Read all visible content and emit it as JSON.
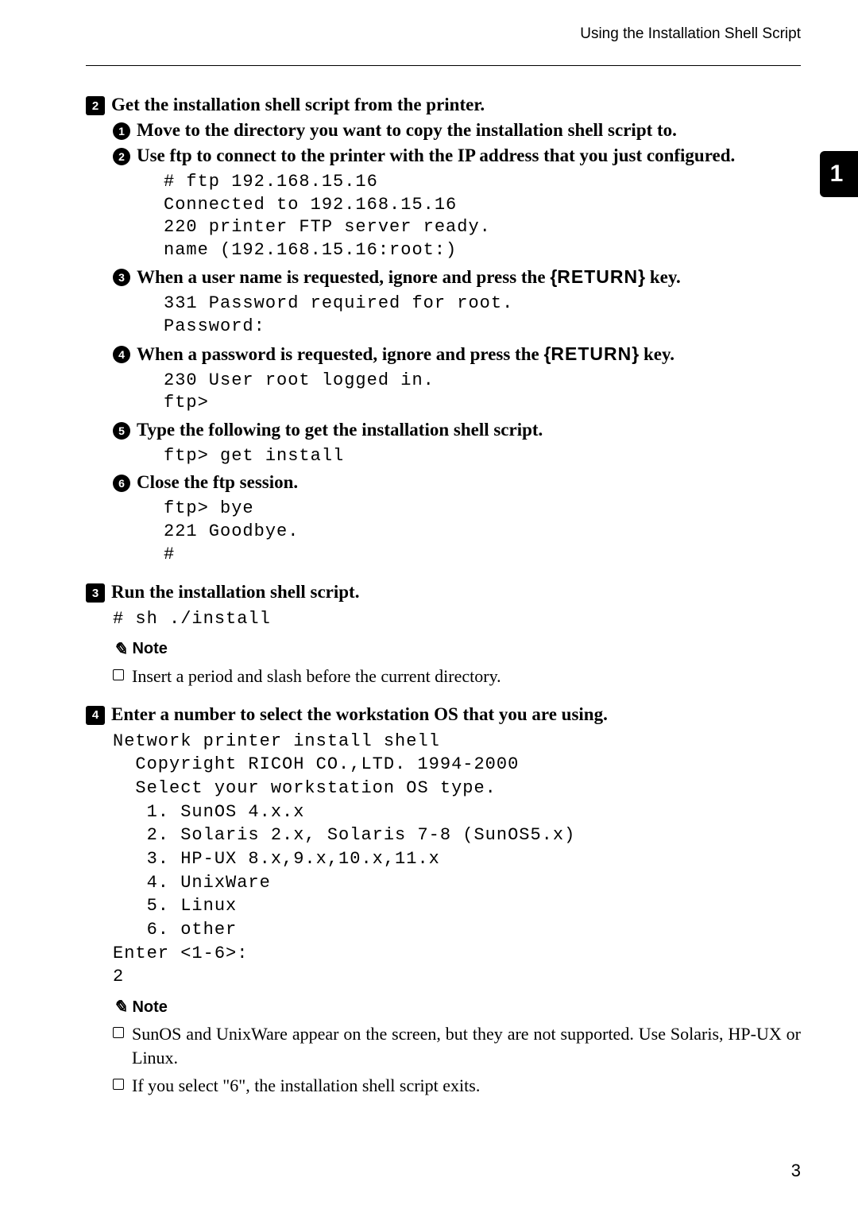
{
  "header": {
    "section_title": "Using the Installation Shell Script"
  },
  "side_tab": "1",
  "page_number": "3",
  "steps": {
    "s2": {
      "num": "2",
      "text": "Get the installation shell script from the printer.",
      "subs": {
        "a": {
          "num": "1",
          "text": "Move to the directory you want to copy the installation shell script to."
        },
        "b": {
          "num": "2",
          "text": "Use ftp to connect to the printer with the IP address that you just configured.",
          "code": "# ftp 192.168.15.16\nConnected to 192.168.15.16\n220 printer FTP server ready.\nname (192.168.15.16:root:)"
        },
        "c": {
          "num": "3",
          "text_pre": "When a user name is requested, ignore and press the ",
          "key": "RETURN",
          "text_post": " key.",
          "code": "331 Password required for root.\nPassword:"
        },
        "d": {
          "num": "4",
          "text_pre": "When a password is requested, ignore and press the ",
          "key": "RETURN",
          "text_post": " key.",
          "code": "230 User root logged in.\nftp>"
        },
        "e": {
          "num": "5",
          "text": "Type the following to get the installation shell script.",
          "code": "ftp> get install"
        },
        "f": {
          "num": "6",
          "text": "Close the ftp session.",
          "code": "ftp> bye\n221 Goodbye.\n#"
        }
      }
    },
    "s3": {
      "num": "3",
      "text": "Run the installation shell script.",
      "code": "# sh ./install",
      "note_label": "Note",
      "note1": "Insert a period and slash before the current directory."
    },
    "s4": {
      "num": "4",
      "text": "Enter a number to select the workstation OS that you are using.",
      "code": "Network printer install shell\n  Copyright RICOH CO.,LTD. 1994-2000\n  Select your workstation OS type.\n   1. SunOS 4.x.x\n   2. Solaris 2.x, Solaris 7-8 (SunOS5.x)\n   3. HP-UX 8.x,9.x,10.x,11.x\n   4. UnixWare\n   5. Linux\n   6. other\nEnter <1-6>:\n2",
      "note_label": "Note",
      "note1": "SunOS and UnixWare appear on the screen, but they are not supported. Use Solaris, HP-UX or Linux.",
      "note2": "If you select \"6\", the installation shell script exits."
    }
  }
}
